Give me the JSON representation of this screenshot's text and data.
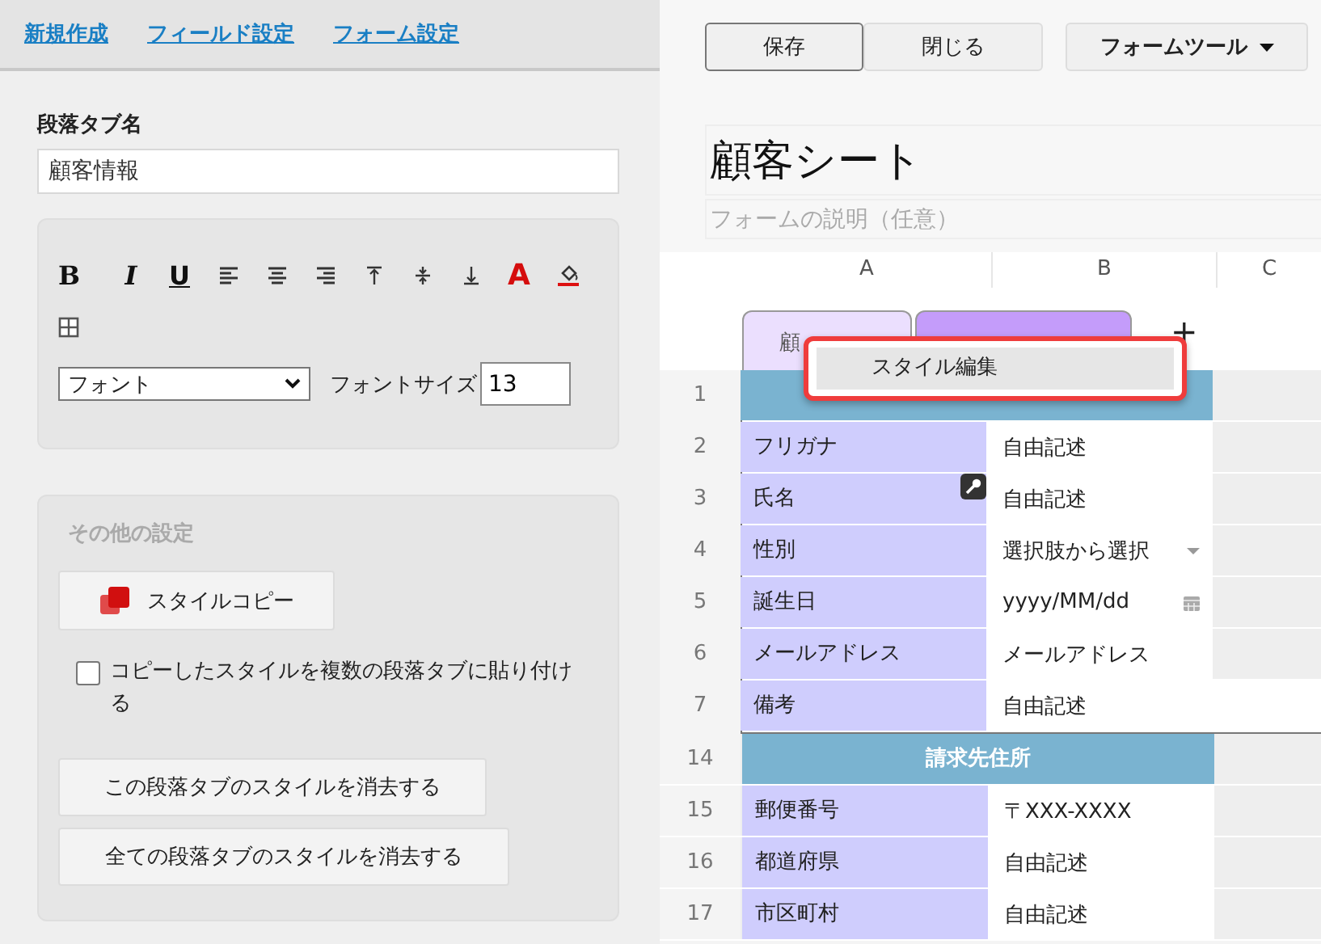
{
  "nav_links": [
    {
      "label": "新規作成"
    },
    {
      "label": "フィールド設定"
    },
    {
      "label": "フォーム設定"
    }
  ],
  "tab_name_field": {
    "label": "段落タブ名",
    "value": "顧客情報"
  },
  "format_tools": [
    {
      "kind": "bold",
      "text": "B"
    },
    {
      "kind": "italic",
      "text": "I"
    },
    {
      "kind": "underline",
      "text": "U"
    },
    {
      "kind": "align-left"
    },
    {
      "kind": "align-center"
    },
    {
      "kind": "align-right"
    },
    {
      "kind": "valign-top"
    },
    {
      "kind": "valign-middle"
    },
    {
      "kind": "valign-bottom"
    },
    {
      "kind": "font-color",
      "text": "A"
    },
    {
      "kind": "fill-color"
    },
    {
      "kind": "borders"
    }
  ],
  "font_select": {
    "value": "フォント"
  },
  "font_size": {
    "label": "フォントサイズ",
    "value": "13"
  },
  "other_settings": {
    "title": "その他の設定",
    "copy_button": "スタイルコピー",
    "checkbox": {
      "label": "コピーしたスタイルを複数の段落タブに貼り付ける",
      "checked": false
    },
    "buttons": [
      "この段落タブのスタイルを消去する",
      "全ての段落タブのスタイルを消去する"
    ]
  },
  "toolbar": {
    "buttons": [
      {
        "label": "保存",
        "focused": true
      },
      {
        "label": "閉じる",
        "focused": false
      }
    ],
    "menu_button": "フォームツール"
  },
  "form": {
    "title": "顧客シート",
    "description_placeholder": "フォームの説明（任意）"
  },
  "grid": {
    "columns": [
      "A",
      "B",
      "C"
    ],
    "tabs": [
      {
        "label": "顧",
        "selected": true
      },
      {
        "selected": false
      }
    ],
    "add_tab": "+",
    "context_menu": {
      "items": [
        {
          "label": "スタイル編集"
        }
      ]
    },
    "rows": [
      {
        "number": "1",
        "kind": "header"
      },
      {
        "number": "2",
        "kind": "field",
        "label": "フリガナ",
        "value": "自由記述"
      },
      {
        "number": "3",
        "kind": "field",
        "label": "氏名",
        "value": "自由記述",
        "key": true
      },
      {
        "number": "4",
        "kind": "field",
        "label": "性別",
        "value": "選択肢から選択",
        "dropdown": true
      },
      {
        "number": "5",
        "kind": "field",
        "label": "誕生日",
        "value": "yyyy/MM/dd",
        "calendar": true
      },
      {
        "number": "6",
        "kind": "field",
        "label": "メールアドレス",
        "value": "メールアドレス"
      },
      {
        "number": "7",
        "kind": "field",
        "label": "備考",
        "value": "自由記述"
      },
      {
        "number": "14",
        "kind": "header",
        "title": "請求先住所"
      },
      {
        "number": "15",
        "kind": "field",
        "label": "郵便番号",
        "value": "〒XXX-XXXX"
      },
      {
        "number": "16",
        "kind": "field",
        "label": "都道府県",
        "value": "自由記述"
      },
      {
        "number": "17",
        "kind": "field",
        "label": "市区町村",
        "value": "自由記述"
      }
    ]
  }
}
